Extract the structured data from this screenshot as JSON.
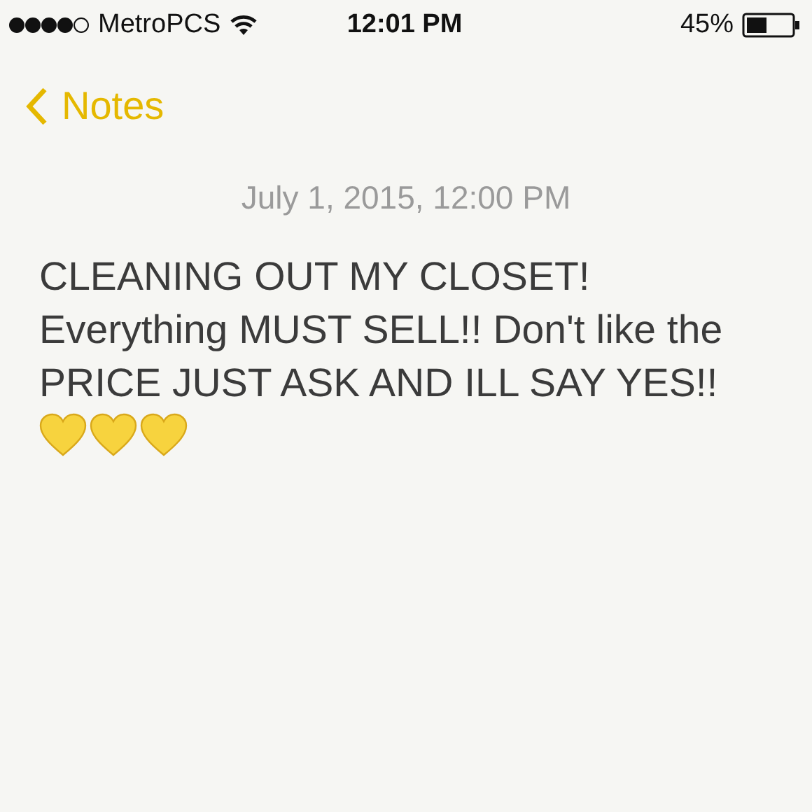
{
  "status_bar": {
    "carrier": "MetroPCS",
    "time": "12:01 PM",
    "battery": "45%"
  },
  "nav": {
    "back": "Notes"
  },
  "note": {
    "date": "July 1, 2015, 12:00 PM",
    "text": "CLEANING OUT MY CLOSET! Everything MUST SELL!! Don't like the PRICE JUST ASK AND ILL SAY YES!!",
    "emoji": [
      {
        "kind": "heart"
      },
      {
        "kind": "heart"
      },
      {
        "kind": "heart"
      }
    ]
  }
}
